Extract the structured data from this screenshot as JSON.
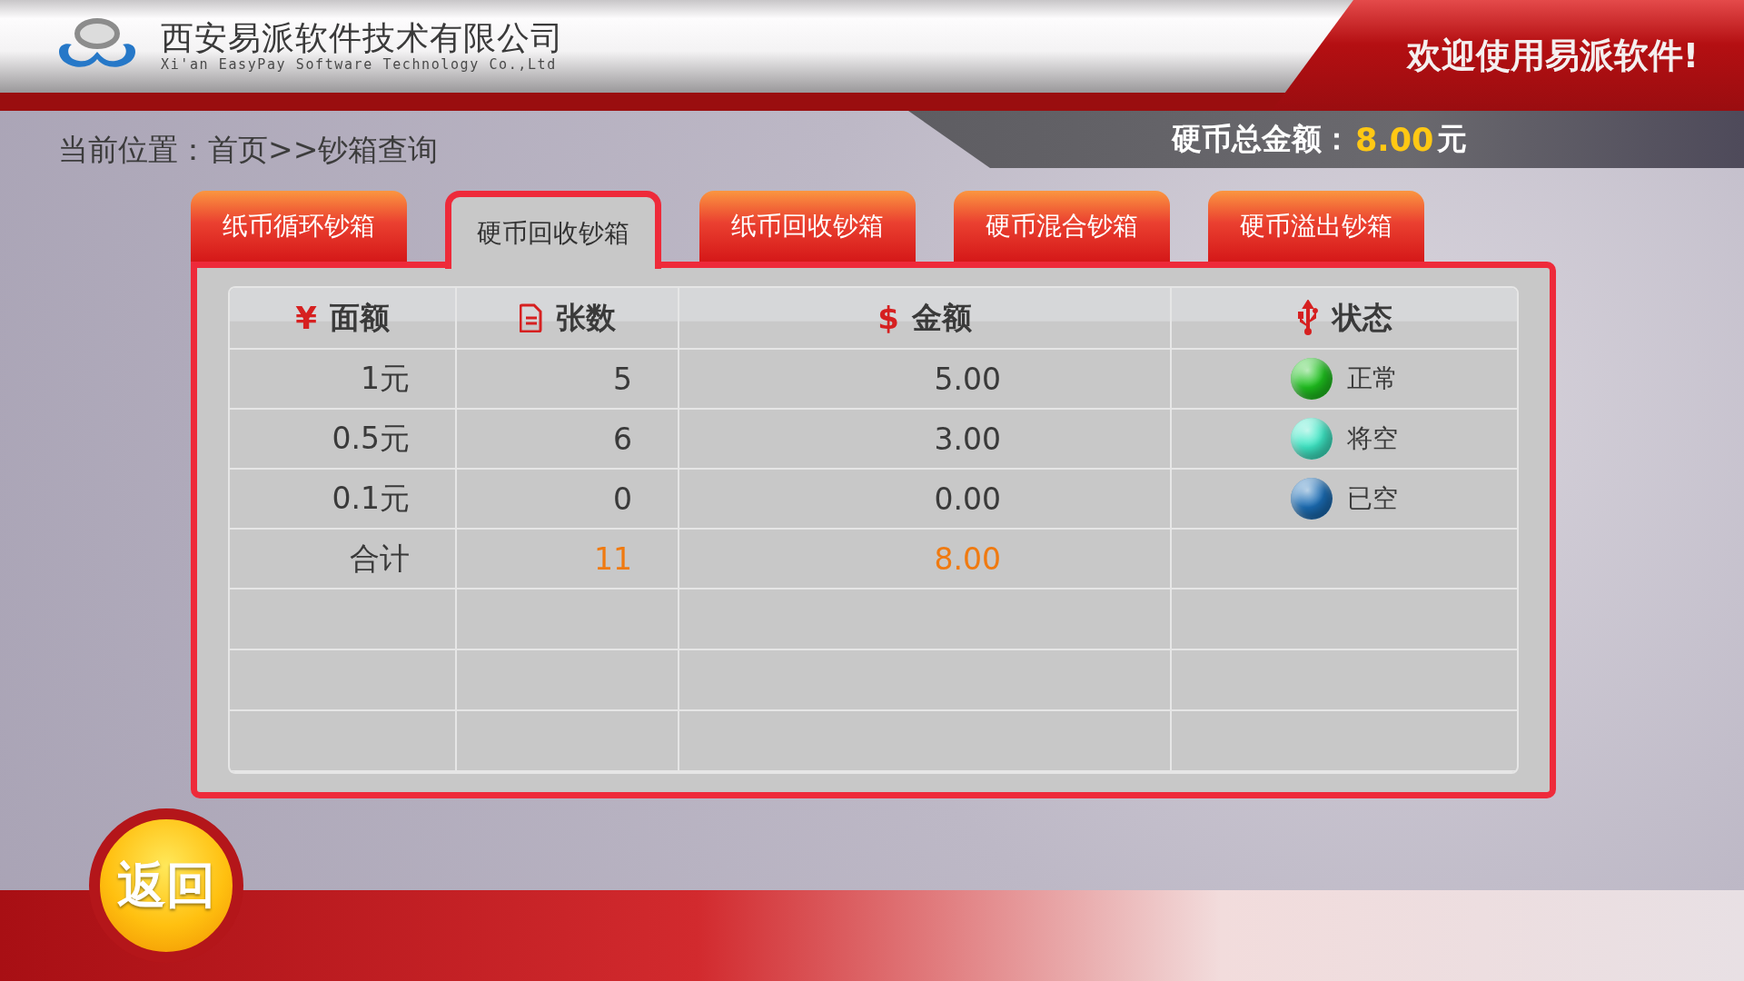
{
  "header": {
    "company_name": "西安易派软件技术有限公司",
    "company_name_en": "Xi'an EasyPay Software Technology Co.,Ltd",
    "welcome": "欢迎使用易派软件!"
  },
  "breadcrumb": "当前位置：首页>>钞箱查询",
  "coin_total": {
    "label": "硬币总金额：",
    "amount": "8.00",
    "unit": "元"
  },
  "tabs": [
    {
      "label": "纸币循环钞箱",
      "selected": false
    },
    {
      "label": "硬币回收钞箱",
      "selected": true
    },
    {
      "label": "纸币回收钞箱",
      "selected": false
    },
    {
      "label": "硬币混合钞箱",
      "selected": false
    },
    {
      "label": "硬币溢出钞箱",
      "selected": false
    }
  ],
  "table": {
    "columns": [
      {
        "label": "面额",
        "kind": "glyph",
        "symbol": "¥"
      },
      {
        "label": "张数",
        "kind": "document"
      },
      {
        "label": "金额",
        "kind": "glyph",
        "symbol": "$"
      },
      {
        "label": "状态",
        "kind": "usb"
      }
    ],
    "rows": [
      {
        "kind": "item",
        "denomination": "1元",
        "count": "5",
        "amount": "5.00",
        "status": "正常",
        "color": "#1fc21f"
      },
      {
        "kind": "item",
        "denomination": "0.5元",
        "count": "6",
        "amount": "3.00",
        "status": "将空",
        "color": "#3ee8c6"
      },
      {
        "kind": "item",
        "denomination": "0.1元",
        "count": "0",
        "amount": "0.00",
        "status": "已空",
        "color": "#1b6db5"
      },
      {
        "kind": "total",
        "denomination": "合计",
        "count": "11",
        "amount": "8.00"
      }
    ]
  },
  "back_button": "返回"
}
